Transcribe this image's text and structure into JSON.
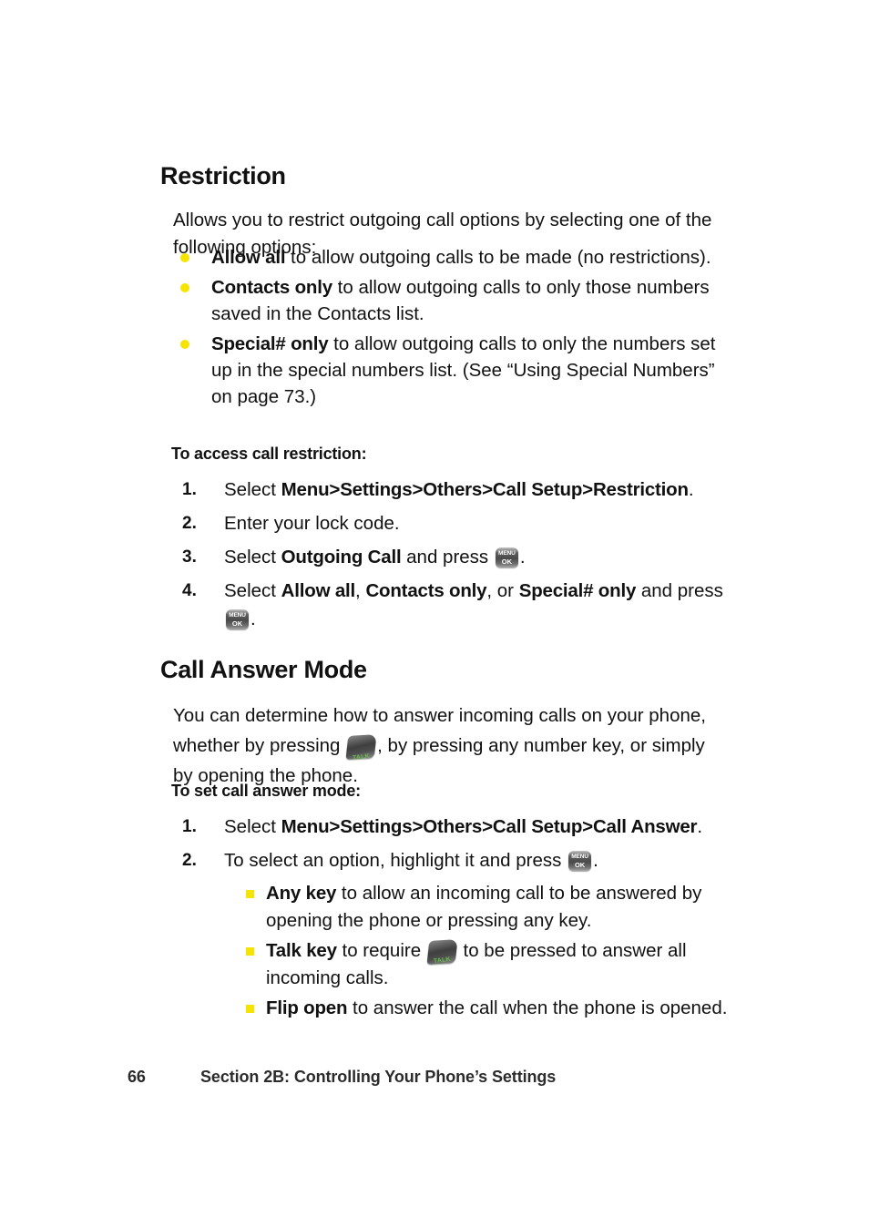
{
  "page": {
    "number": "66",
    "footer_section": "Section 2B: Controlling Your Phone’s Settings"
  },
  "sections": [
    {
      "heading": "Restriction",
      "intro": "Allows you to restrict outgoing call options by selecting one of the following options:",
      "bullets": [
        {
          "term": "Allow all",
          "rest": " to allow outgoing calls to be made (no restrictions)."
        },
        {
          "term": "Contacts only",
          "rest": " to allow outgoing calls to only those numbers saved in the Contacts list."
        },
        {
          "term": "Special# only",
          "rest": " to allow outgoing calls to only the numbers set up in the special numbers list. (See “Using Special Numbers” on page 73.)"
        }
      ],
      "subhead": "To access call restriction:",
      "steps": [
        {
          "num": "1.",
          "lead": "Select ",
          "path": [
            "Menu",
            "Settings",
            "Others",
            "Call Setup",
            "Restriction"
          ],
          "tail": "."
        },
        {
          "num": "2.",
          "text": "Enter your lock code."
        },
        {
          "num": "3.",
          "lead": "Select ",
          "bold": "Outgoing Call",
          "mid": " and press ",
          "icon": "menu-ok-key",
          "tail": "."
        },
        {
          "num": "4.",
          "lead": "Select ",
          "bold1": "Allow all",
          "sep1": ", ",
          "bold2": "Contacts only",
          "sep2": ", or ",
          "bold3": "Special# only",
          "mid": " and press ",
          "icon": "menu-ok-key",
          "tail": "."
        }
      ]
    },
    {
      "heading": "Call Answer Mode",
      "intro_part1": "You can determine how to answer incoming calls on your phone, whether by pressing ",
      "intro_icon": "talk-key",
      "intro_part2": ", by pressing any number key, or simply by opening the phone.",
      "subhead": "To set call answer mode:",
      "steps": [
        {
          "num": "1.",
          "lead": "Select ",
          "path": [
            "Menu",
            "Settings",
            "Others",
            "Call Setup",
            "Call Answer"
          ],
          "tail": "."
        },
        {
          "num": "2.",
          "lead": "To select an option, highlight it and press ",
          "icon": "menu-ok-key",
          "tail": "."
        }
      ],
      "sub_bullets": [
        {
          "term": "Any key",
          "rest": " to allow an incoming call to be answered by opening the phone or pressing any key."
        },
        {
          "term": "Talk key",
          "rest_pre": " to require ",
          "icon": "talk-key",
          "rest_post": " to be pressed to answer all incoming calls."
        },
        {
          "term": "Flip open",
          "rest": " to answer the call when the phone is opened."
        }
      ]
    }
  ],
  "icons": {
    "menu_ok_key": {
      "label_top": "MENU",
      "label_bottom": "OK"
    },
    "talk_key": {
      "label": "TALK",
      "text_color": "#62bb46"
    }
  },
  "colors": {
    "bullet_yellow": "#f5e400",
    "text": "#111111",
    "footer_text": "#2b2b2b"
  },
  "chevron": ">"
}
